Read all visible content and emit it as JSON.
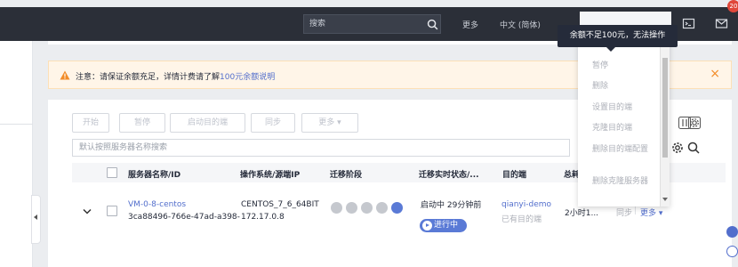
{
  "header": {
    "search_placeholder": "搜索",
    "more": "更多",
    "language": "中文 (简体)",
    "message_count": "20"
  },
  "notice": {
    "text": "注意：请保证余额充足，详情计费请了解",
    "link": "100元余额说明"
  },
  "toolbar": {
    "start": "开始",
    "pause": "暂停",
    "launch_target": "启动目的端",
    "sync": "同步",
    "more": "更多 ▾"
  },
  "filter": {
    "placeholder": "默认按照服务器名称搜索"
  },
  "table": {
    "headers": {
      "name": "服务器名称/ID",
      "os_ip": "操作系统/源端IP",
      "phase": "迁移阶段",
      "status": "迁移实时状态/...",
      "target": "目的端",
      "total": "总耗"
    },
    "rows": [
      {
        "name": "VM-0-8-centos",
        "id": "3ca88496-766e-47ad-a398-c",
        "os": "CENTOS_7_6_64BIT",
        "ip": "172.17.0.8",
        "status": "启动中 29分钟前",
        "status_badge": "进行中",
        "target_name": "qianyi-demo",
        "target_note": "已有目的端",
        "total": "2小时1...",
        "sync_action": "同步",
        "more_action": "更多 ▾"
      }
    ]
  },
  "dropdown_menu": {
    "items": [
      "暂停",
      "删除",
      "设置目的端",
      "克隆目的端",
      "删除目的端配置",
      "删除克隆服务器"
    ]
  },
  "tooltip": "余额不足100元，无法操作",
  "colors": {
    "topbar": "#2b2f38",
    "link": "#526ecc",
    "badge": "#5a7ad6",
    "warning": "#f28c28"
  }
}
